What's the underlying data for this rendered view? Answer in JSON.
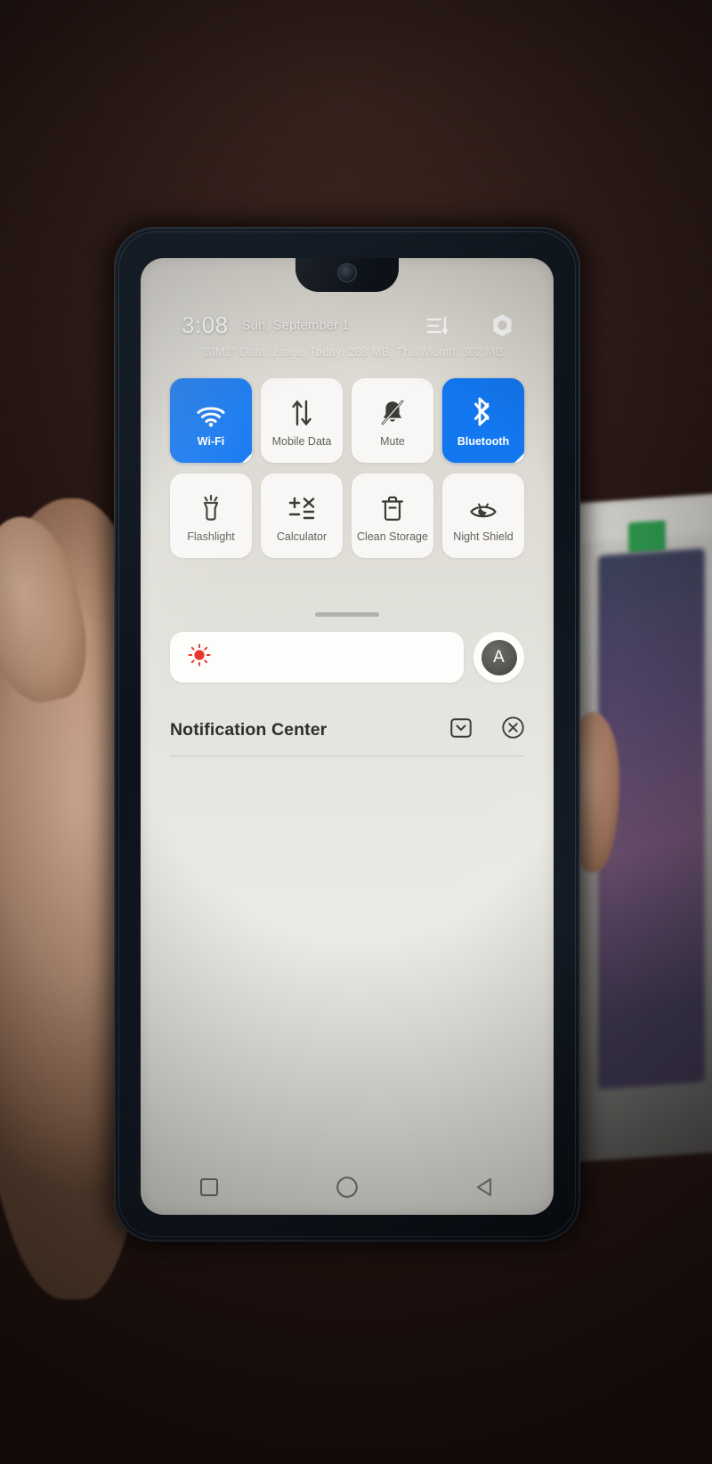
{
  "status": {
    "time": "3:08",
    "date": "Sun, September 1",
    "icons": [
      {
        "name": "sort-lines-icon",
        "label": "Edit order"
      },
      {
        "name": "settings-gear-icon",
        "label": "Settings"
      }
    ]
  },
  "data_usage": "\"SIM1\" Data Usage, Today: 288 MB, This Month: 302 MB",
  "tiles": [
    {
      "label": "Wi-Fi",
      "icon": "wifi-icon",
      "active": true,
      "has_corner": true
    },
    {
      "label": "Mobile Data",
      "icon": "mobile-data-icon",
      "active": false,
      "has_corner": false
    },
    {
      "label": "Mute",
      "icon": "bell-muted-icon",
      "active": false,
      "has_corner": false
    },
    {
      "label": "Bluetooth",
      "icon": "bluetooth-icon",
      "active": true,
      "has_corner": true
    },
    {
      "label": "Flashlight",
      "icon": "flashlight-icon",
      "active": false,
      "has_corner": false
    },
    {
      "label": "Calculator",
      "icon": "calculator-icon",
      "active": false,
      "has_corner": false
    },
    {
      "label": "Clean Storage",
      "icon": "trash-clean-icon",
      "active": false,
      "has_corner": false
    },
    {
      "label": "Night Shield",
      "icon": "night-shield-icon",
      "active": false,
      "has_corner": false
    }
  ],
  "brightness": {
    "icon": "brightness-sun-icon",
    "auto_label": "A",
    "level_percent": 0
  },
  "notification_center": {
    "title": "Notification Center",
    "icons": [
      {
        "name": "notification-settings-icon"
      },
      {
        "name": "clear-all-icon"
      }
    ]
  },
  "navbar": [
    {
      "name": "recents-square-button"
    },
    {
      "name": "home-circle-button"
    },
    {
      "name": "back-triangle-button"
    }
  ],
  "colors": {
    "tile_active": "#1377f0",
    "tile_inactive": "#fcfbf9",
    "screen_bg": "#e8e6e0",
    "label": "#63615e",
    "brightness_accent": "#e8362a"
  }
}
